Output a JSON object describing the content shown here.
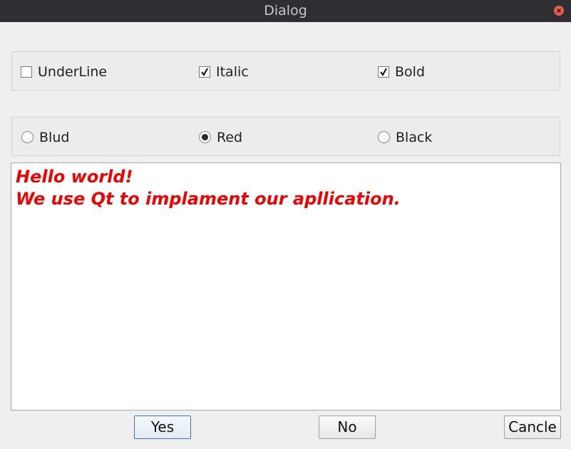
{
  "window": {
    "title": "Dialog"
  },
  "style_options": [
    {
      "label": "UnderLine",
      "checked": false
    },
    {
      "label": "Italic",
      "checked": true
    },
    {
      "label": "Bold",
      "checked": true
    }
  ],
  "color_options": [
    {
      "label": "Blud",
      "selected": false
    },
    {
      "label": "Red",
      "selected": true
    },
    {
      "label": "Black",
      "selected": false
    }
  ],
  "editor": {
    "text": "Hello world!\nWe use Qt to implament our apllication.",
    "text_color": "#f00000"
  },
  "buttons": {
    "yes": "Yes",
    "no": "No",
    "cancel": "Cancle"
  }
}
